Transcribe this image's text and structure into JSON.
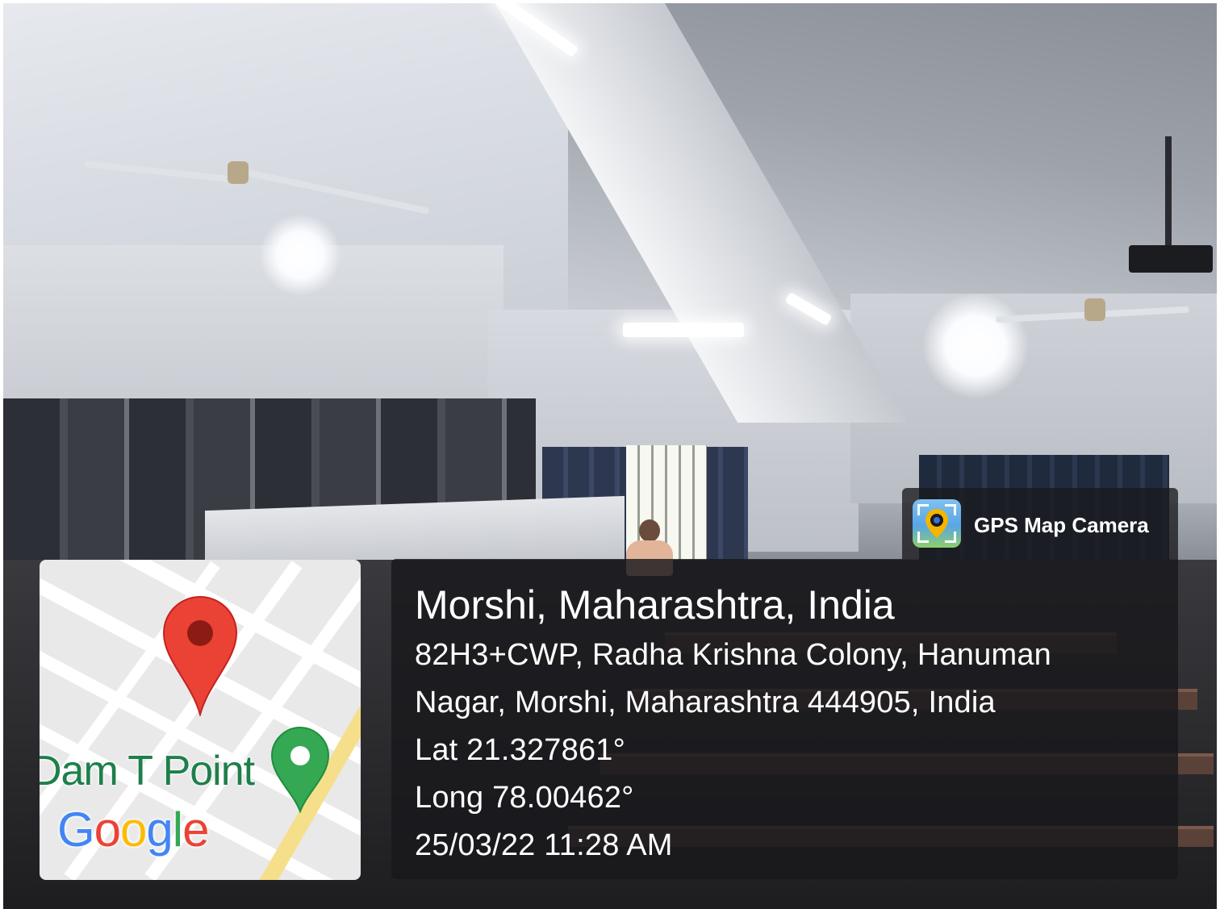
{
  "app_badge": {
    "name": "GPS Map Camera",
    "icon": "gps-camera-icon"
  },
  "map": {
    "place_label": "Dam T Point",
    "logo_text": [
      "G",
      "o",
      "o",
      "g",
      "l",
      "e"
    ],
    "logo_colors": [
      "#4285F4",
      "#EA4335",
      "#FBBC05",
      "#4285F4",
      "#34A853",
      "#EA4335"
    ],
    "pins": [
      "red-location-pin-icon",
      "green-location-pin-icon"
    ]
  },
  "location": {
    "title": "Morshi, Maharashtra, India",
    "address_line1": "82H3+CWP, Radha Krishna Colony, Hanuman",
    "address_line2": "Nagar, Morshi, Maharashtra 444905, India",
    "latitude": "Lat 21.327861°",
    "longitude": "Long 78.00462°",
    "datetime": "25/03/22 11:28 AM"
  },
  "colors": {
    "panel_bg": "#19191c",
    "text": "#ffffff",
    "pin_red": "#EA4335",
    "pin_green": "#34A853"
  }
}
